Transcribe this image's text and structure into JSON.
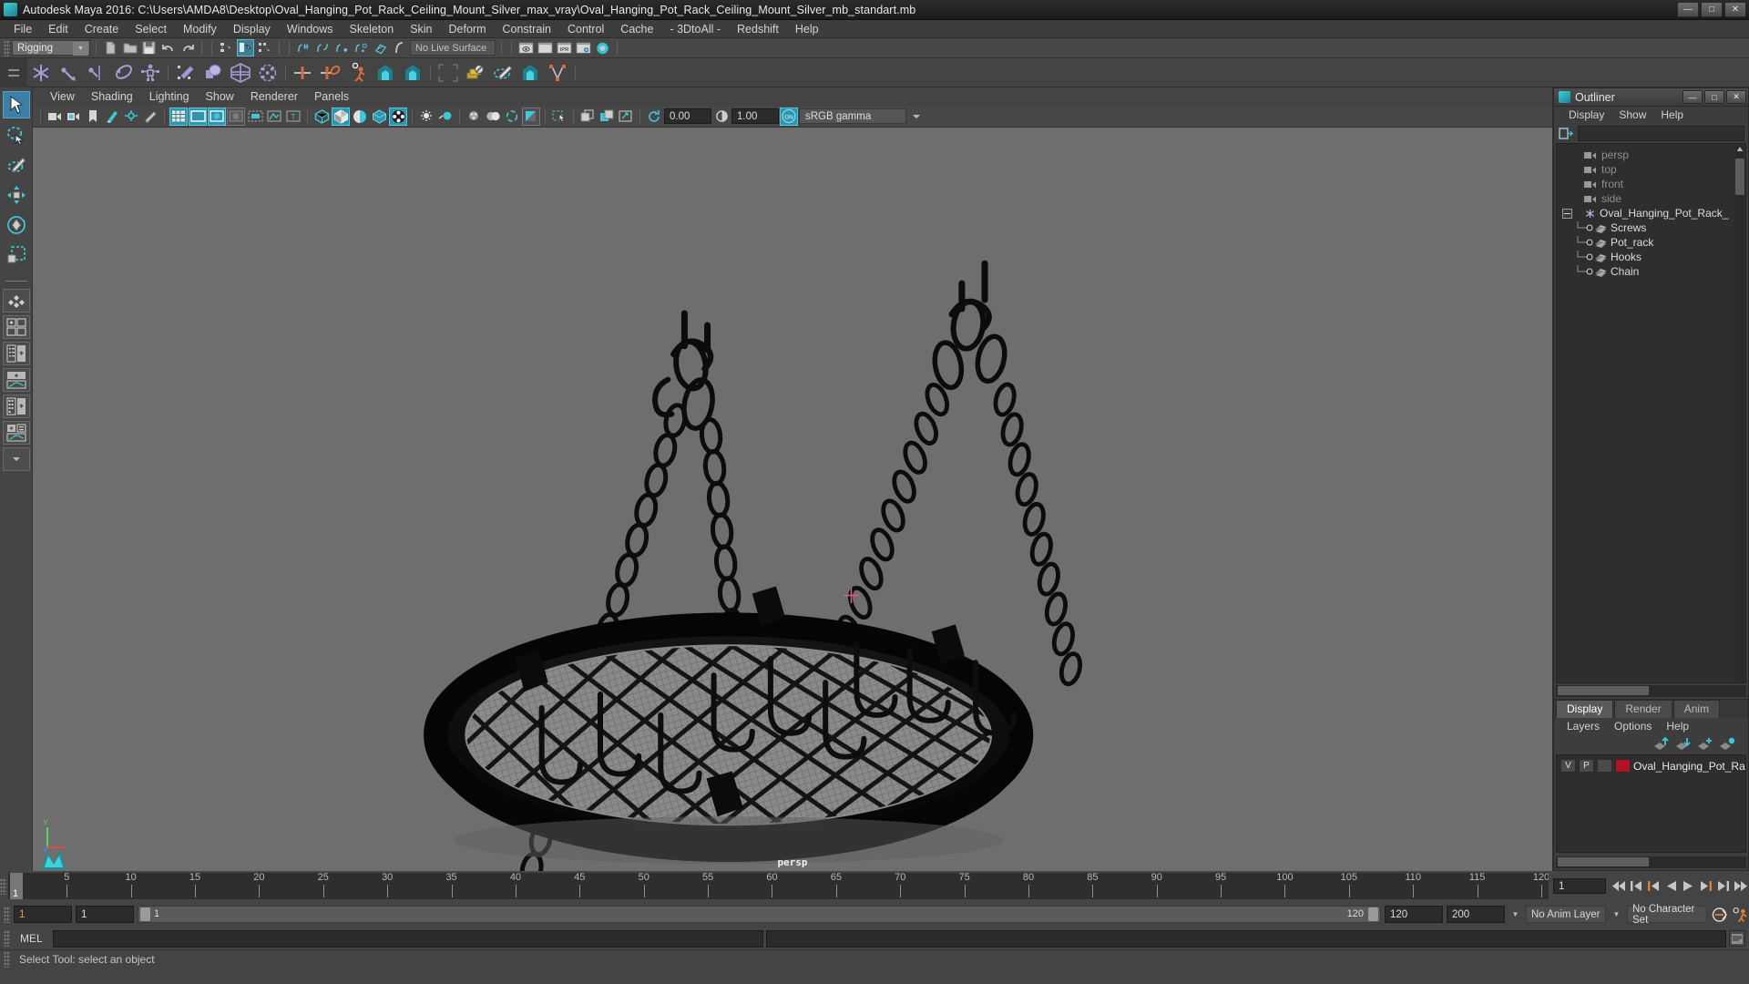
{
  "window": {
    "title": "Autodesk Maya 2016: C:\\Users\\AMDA8\\Desktop\\Oval_Hanging_Pot_Rack_Ceiling_Mount_Silver_max_vray\\Oval_Hanging_Pot_Rack_Ceiling_Mount_Silver_mb_standart.mb",
    "minimize": "—",
    "maximize": "□",
    "close": "✕"
  },
  "menubar": {
    "items": [
      "File",
      "Edit",
      "Create",
      "Select",
      "Modify",
      "Display",
      "Windows",
      "Skeleton",
      "Skin",
      "Deform",
      "Constrain",
      "Control",
      "Cache",
      "- 3DtoAll -",
      "Redshift",
      "Help"
    ]
  },
  "status_line": {
    "menu_set": "Rigging",
    "live_surface": "No Live Surface",
    "ipr_label": "IPR"
  },
  "viewport_menus": {
    "items": [
      "View",
      "Shading",
      "Lighting",
      "Show",
      "Renderer",
      "Panels"
    ]
  },
  "viewport_toolbar": {
    "exposure": "0.00",
    "gamma": "1.00",
    "color_profile": "sRGB gamma",
    "gamma_toggle": "ON"
  },
  "viewport": {
    "camera_label": "persp",
    "axis_y": "Y",
    "background_color": "#6e6e6e",
    "model_color": "#0d0d0d",
    "mesh_fill": "#8a8a8a"
  },
  "outliner": {
    "title": "Outliner",
    "menus": [
      "Display",
      "Show",
      "Help"
    ],
    "search_value": "",
    "window_buttons": {
      "minimize": "—",
      "maximize": "□",
      "close": "✕"
    },
    "items": [
      {
        "label": "persp",
        "type": "camera",
        "indent": 0,
        "dim": true
      },
      {
        "label": "top",
        "type": "camera",
        "indent": 0,
        "dim": true
      },
      {
        "label": "front",
        "type": "camera",
        "indent": 0,
        "dim": true
      },
      {
        "label": "side",
        "type": "camera",
        "indent": 0,
        "dim": true
      },
      {
        "label": "Oval_Hanging_Pot_Rack_",
        "type": "group",
        "indent": 0,
        "dim": false,
        "expanded": true
      },
      {
        "label": "Screws",
        "type": "mesh",
        "indent": 1,
        "dim": false
      },
      {
        "label": "Pot_rack",
        "type": "mesh",
        "indent": 1,
        "dim": false
      },
      {
        "label": "Hooks",
        "type": "mesh",
        "indent": 1,
        "dim": false
      },
      {
        "label": "Chain",
        "type": "mesh",
        "indent": 1,
        "dim": false
      }
    ]
  },
  "layer_editor": {
    "tabs": [
      {
        "label": "Display",
        "active": true
      },
      {
        "label": "Render",
        "active": false
      },
      {
        "label": "Anim",
        "active": false
      }
    ],
    "menus": [
      "Layers",
      "Options",
      "Help"
    ],
    "layers": [
      {
        "visibility": "V",
        "playback": "P",
        "shading": "",
        "color": "#b01424",
        "name": "Oval_Hanging_Pot_Ra"
      }
    ]
  },
  "time_slider": {
    "current_frame": "1",
    "current_frame_field": "1",
    "tick_labels": [
      "5",
      "10",
      "15",
      "20",
      "25",
      "30",
      "35",
      "40",
      "45",
      "50",
      "55",
      "60",
      "65",
      "70",
      "75",
      "80",
      "85",
      "90",
      "95",
      "100",
      "105",
      "110",
      "115",
      "120"
    ],
    "range_start": 1,
    "range_end": 120
  },
  "range_slider": {
    "anim_start": "1",
    "range_start": "1",
    "bar_start_label": "1",
    "bar_end_label": "120",
    "range_end": "120",
    "anim_end": "200",
    "anim_layer": "No Anim Layer",
    "character_set": "No Character Set"
  },
  "command_line": {
    "language": "MEL",
    "input_value": "",
    "output_value": ""
  },
  "help_line": {
    "message": "Select Tool: select an object"
  }
}
